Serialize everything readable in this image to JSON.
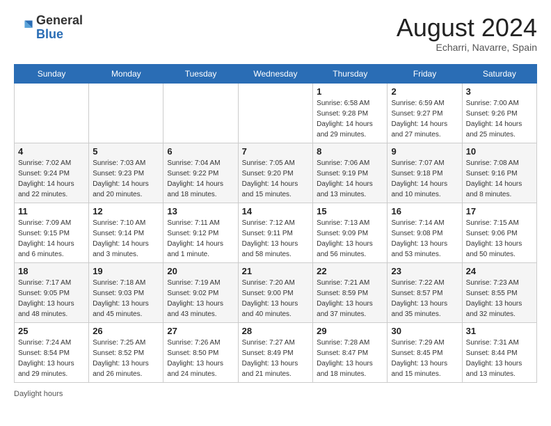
{
  "header": {
    "logo_general": "General",
    "logo_blue": "Blue",
    "month_title": "August 2024",
    "subtitle": "Echarri, Navarre, Spain"
  },
  "days_of_week": [
    "Sunday",
    "Monday",
    "Tuesday",
    "Wednesday",
    "Thursday",
    "Friday",
    "Saturday"
  ],
  "weeks": [
    [
      {
        "day": "",
        "info": ""
      },
      {
        "day": "",
        "info": ""
      },
      {
        "day": "",
        "info": ""
      },
      {
        "day": "",
        "info": ""
      },
      {
        "day": "1",
        "info": "Sunrise: 6:58 AM\nSunset: 9:28 PM\nDaylight: 14 hours\nand 29 minutes."
      },
      {
        "day": "2",
        "info": "Sunrise: 6:59 AM\nSunset: 9:27 PM\nDaylight: 14 hours\nand 27 minutes."
      },
      {
        "day": "3",
        "info": "Sunrise: 7:00 AM\nSunset: 9:26 PM\nDaylight: 14 hours\nand 25 minutes."
      }
    ],
    [
      {
        "day": "4",
        "info": "Sunrise: 7:02 AM\nSunset: 9:24 PM\nDaylight: 14 hours\nand 22 minutes."
      },
      {
        "day": "5",
        "info": "Sunrise: 7:03 AM\nSunset: 9:23 PM\nDaylight: 14 hours\nand 20 minutes."
      },
      {
        "day": "6",
        "info": "Sunrise: 7:04 AM\nSunset: 9:22 PM\nDaylight: 14 hours\nand 18 minutes."
      },
      {
        "day": "7",
        "info": "Sunrise: 7:05 AM\nSunset: 9:20 PM\nDaylight: 14 hours\nand 15 minutes."
      },
      {
        "day": "8",
        "info": "Sunrise: 7:06 AM\nSunset: 9:19 PM\nDaylight: 14 hours\nand 13 minutes."
      },
      {
        "day": "9",
        "info": "Sunrise: 7:07 AM\nSunset: 9:18 PM\nDaylight: 14 hours\nand 10 minutes."
      },
      {
        "day": "10",
        "info": "Sunrise: 7:08 AM\nSunset: 9:16 PM\nDaylight: 14 hours\nand 8 minutes."
      }
    ],
    [
      {
        "day": "11",
        "info": "Sunrise: 7:09 AM\nSunset: 9:15 PM\nDaylight: 14 hours\nand 6 minutes."
      },
      {
        "day": "12",
        "info": "Sunrise: 7:10 AM\nSunset: 9:14 PM\nDaylight: 14 hours\nand 3 minutes."
      },
      {
        "day": "13",
        "info": "Sunrise: 7:11 AM\nSunset: 9:12 PM\nDaylight: 14 hours\nand 1 minute."
      },
      {
        "day": "14",
        "info": "Sunrise: 7:12 AM\nSunset: 9:11 PM\nDaylight: 13 hours\nand 58 minutes."
      },
      {
        "day": "15",
        "info": "Sunrise: 7:13 AM\nSunset: 9:09 PM\nDaylight: 13 hours\nand 56 minutes."
      },
      {
        "day": "16",
        "info": "Sunrise: 7:14 AM\nSunset: 9:08 PM\nDaylight: 13 hours\nand 53 minutes."
      },
      {
        "day": "17",
        "info": "Sunrise: 7:15 AM\nSunset: 9:06 PM\nDaylight: 13 hours\nand 50 minutes."
      }
    ],
    [
      {
        "day": "18",
        "info": "Sunrise: 7:17 AM\nSunset: 9:05 PM\nDaylight: 13 hours\nand 48 minutes."
      },
      {
        "day": "19",
        "info": "Sunrise: 7:18 AM\nSunset: 9:03 PM\nDaylight: 13 hours\nand 45 minutes."
      },
      {
        "day": "20",
        "info": "Sunrise: 7:19 AM\nSunset: 9:02 PM\nDaylight: 13 hours\nand 43 minutes."
      },
      {
        "day": "21",
        "info": "Sunrise: 7:20 AM\nSunset: 9:00 PM\nDaylight: 13 hours\nand 40 minutes."
      },
      {
        "day": "22",
        "info": "Sunrise: 7:21 AM\nSunset: 8:59 PM\nDaylight: 13 hours\nand 37 minutes."
      },
      {
        "day": "23",
        "info": "Sunrise: 7:22 AM\nSunset: 8:57 PM\nDaylight: 13 hours\nand 35 minutes."
      },
      {
        "day": "24",
        "info": "Sunrise: 7:23 AM\nSunset: 8:55 PM\nDaylight: 13 hours\nand 32 minutes."
      }
    ],
    [
      {
        "day": "25",
        "info": "Sunrise: 7:24 AM\nSunset: 8:54 PM\nDaylight: 13 hours\nand 29 minutes."
      },
      {
        "day": "26",
        "info": "Sunrise: 7:25 AM\nSunset: 8:52 PM\nDaylight: 13 hours\nand 26 minutes."
      },
      {
        "day": "27",
        "info": "Sunrise: 7:26 AM\nSunset: 8:50 PM\nDaylight: 13 hours\nand 24 minutes."
      },
      {
        "day": "28",
        "info": "Sunrise: 7:27 AM\nSunset: 8:49 PM\nDaylight: 13 hours\nand 21 minutes."
      },
      {
        "day": "29",
        "info": "Sunrise: 7:28 AM\nSunset: 8:47 PM\nDaylight: 13 hours\nand 18 minutes."
      },
      {
        "day": "30",
        "info": "Sunrise: 7:29 AM\nSunset: 8:45 PM\nDaylight: 13 hours\nand 15 minutes."
      },
      {
        "day": "31",
        "info": "Sunrise: 7:31 AM\nSunset: 8:44 PM\nDaylight: 13 hours\nand 13 minutes."
      }
    ]
  ],
  "footer": {
    "daylight_label": "Daylight hours"
  }
}
